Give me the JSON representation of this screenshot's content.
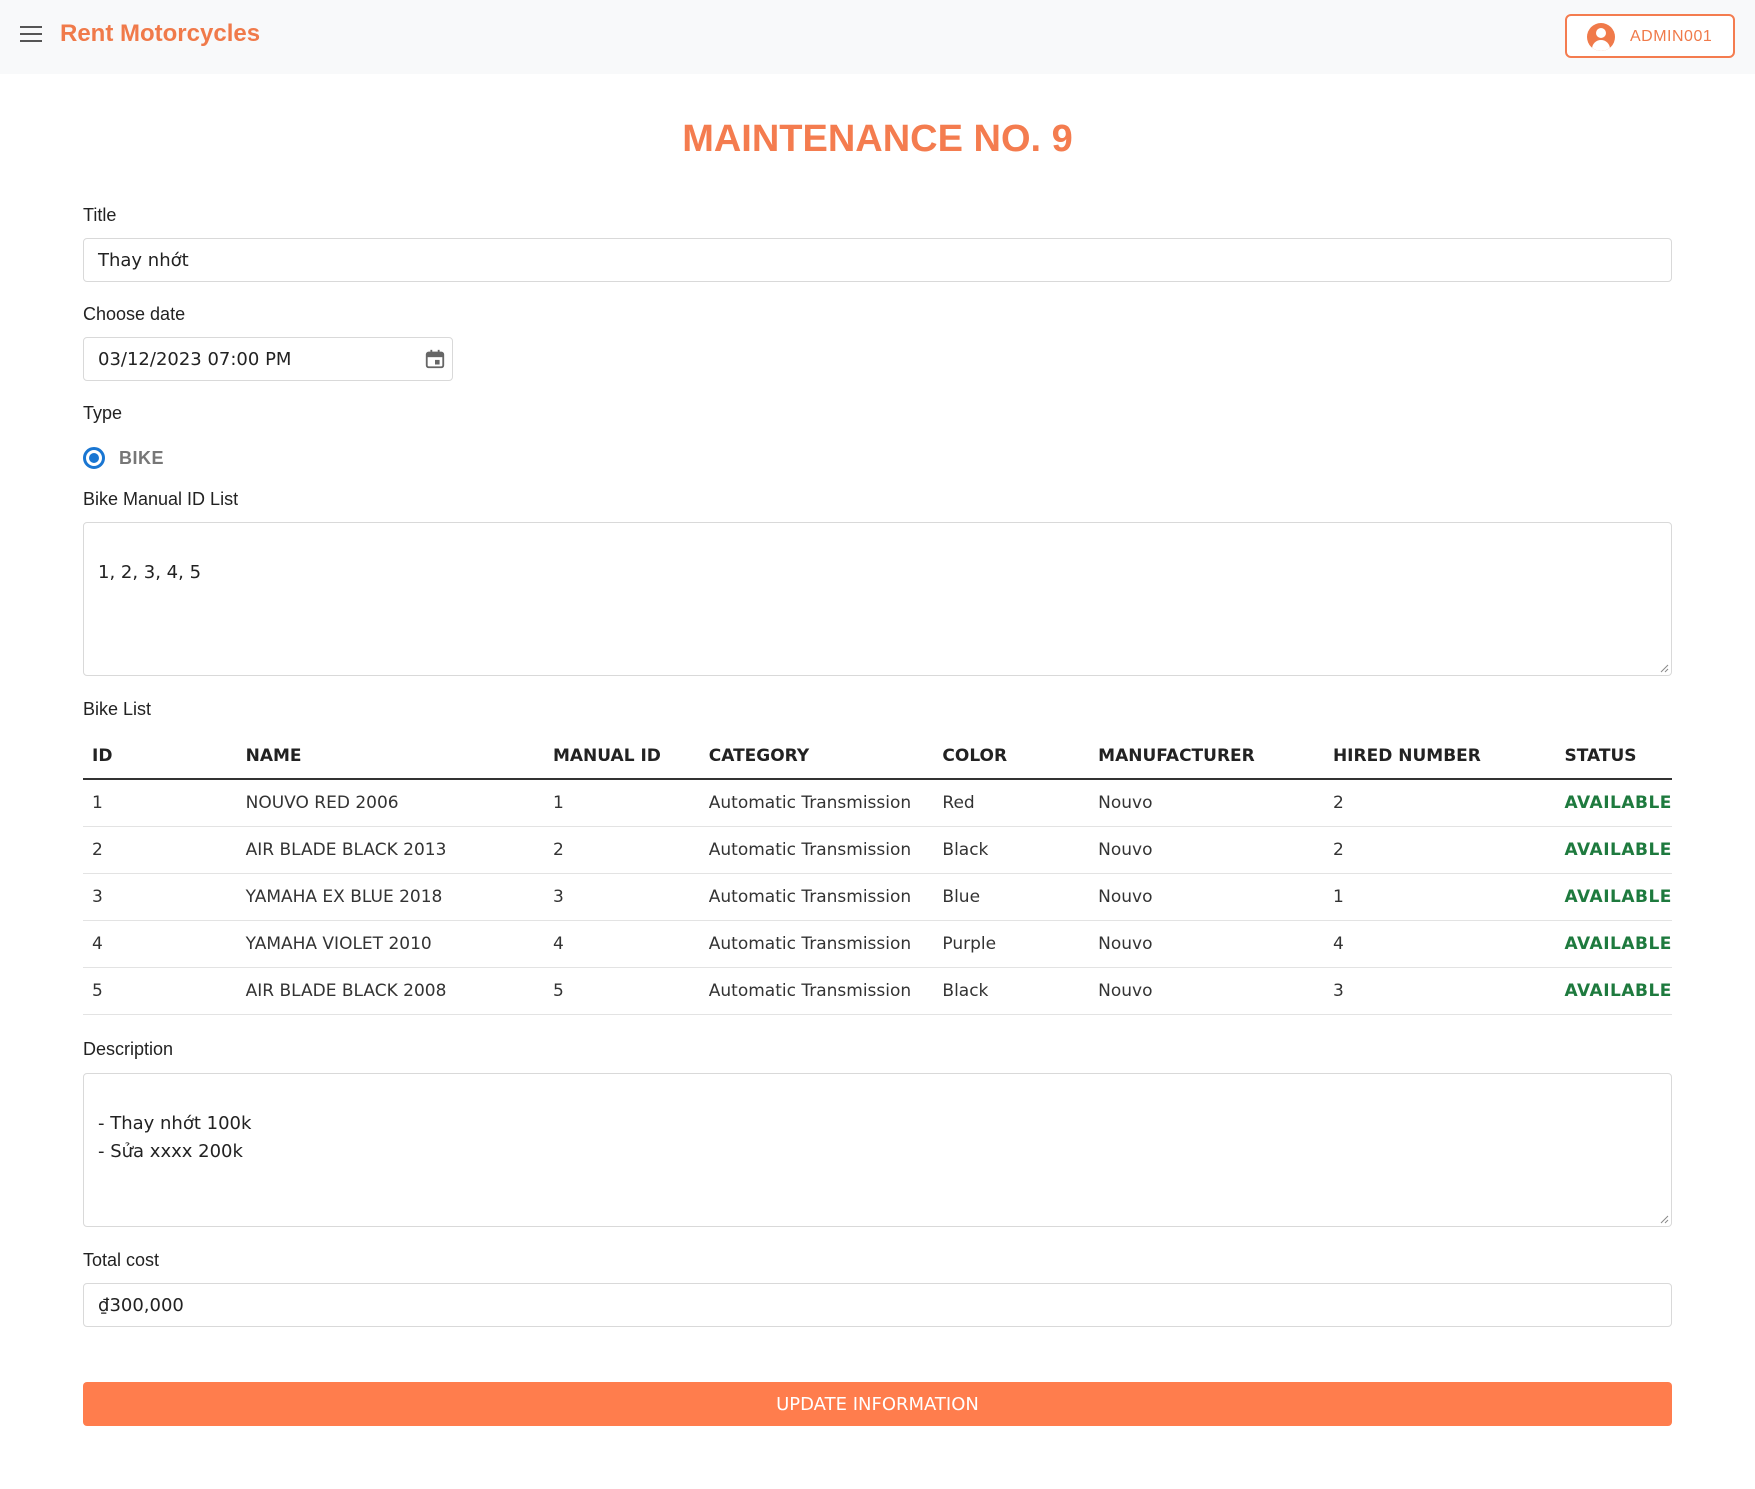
{
  "header": {
    "brand": "Rent Motorcycles",
    "user_label": "ADMIN001",
    "brand_color": "#f07a4a"
  },
  "page": {
    "title": "MAINTENANCE NO. 9"
  },
  "form": {
    "title_label": "Title",
    "title_value": "Thay nhớt",
    "date_label": "Choose date",
    "date_value": "03/12/2023 07:00 PM",
    "type_label": "Type",
    "type_option": "BIKE",
    "manual_id_label": "Bike Manual ID List",
    "manual_id_value": "1, 2, 3, 4, 5",
    "bike_list_label": "Bike List",
    "description_label": "Description",
    "description_value": "- Thay nhớt 100k\n- Sửa xxxx  200k",
    "total_cost_label": "Total cost",
    "total_cost_value": "₫300,000",
    "submit_label": "UPDATE INFORMATION"
  },
  "table": {
    "columns": [
      "ID",
      "NAME",
      "MANUAL ID",
      "CATEGORY",
      "COLOR",
      "MANUFACTURER",
      "HIRED NUMBER",
      "STATUS"
    ],
    "rows": [
      [
        "1",
        "NOUVO RED 2006",
        "1",
        "Automatic Transmission",
        "Red",
        "Nouvo",
        "2",
        "AVAILABLE"
      ],
      [
        "2",
        "AIR BLADE BLACK 2013",
        "2",
        "Automatic Transmission",
        "Black",
        "Nouvo",
        "2",
        "AVAILABLE"
      ],
      [
        "3",
        "YAMAHA EX BLUE 2018",
        "3",
        "Automatic Transmission",
        "Blue",
        "Nouvo",
        "1",
        "AVAILABLE"
      ],
      [
        "4",
        "YAMAHA VIOLET 2010",
        "4",
        "Automatic Transmission",
        "Purple",
        "Nouvo",
        "4",
        "AVAILABLE"
      ],
      [
        "5",
        "AIR BLADE BLACK 2008",
        "5",
        "Automatic Transmission",
        "Black",
        "Nouvo",
        "3",
        "AVAILABLE"
      ]
    ]
  },
  "colors": {
    "accent": "#ff7d4d",
    "status_available": "#1e7a3e",
    "radio": "#1976d2"
  },
  "icons": {
    "menu": "menu-icon",
    "user": "user-circle-icon",
    "calendar": "calendar-icon"
  }
}
